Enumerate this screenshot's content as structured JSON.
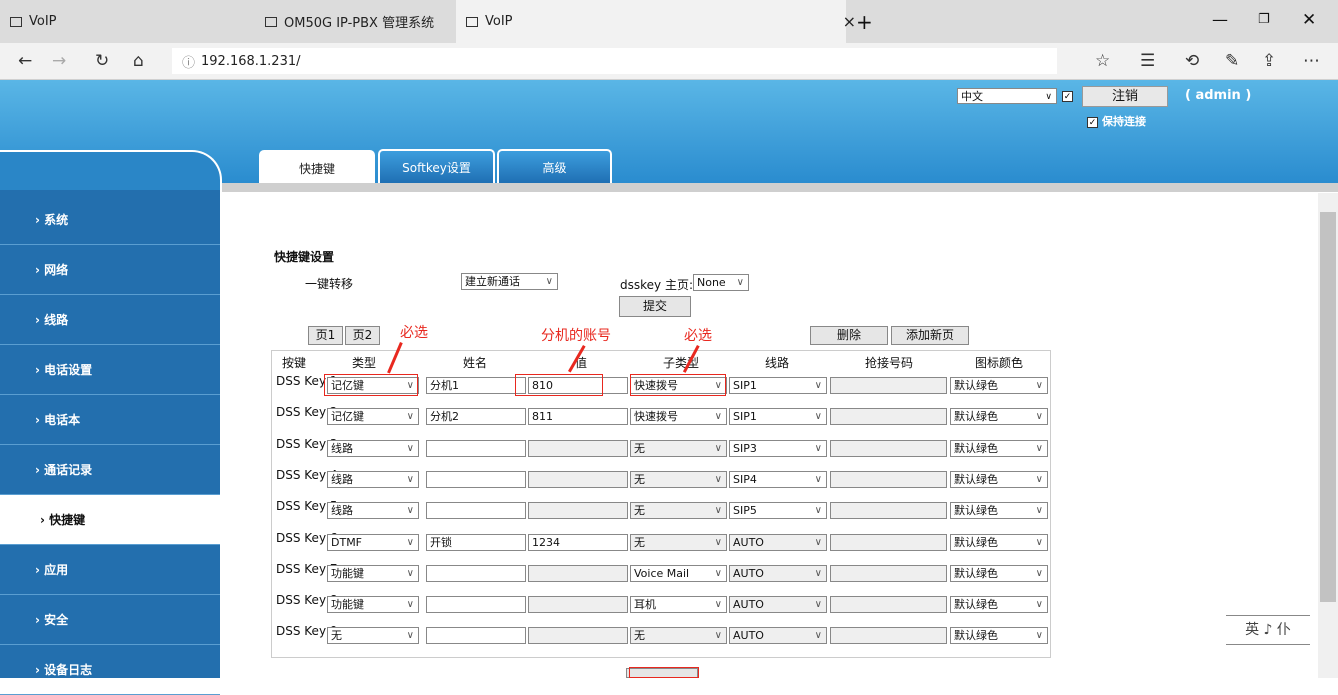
{
  "browser": {
    "tab1": "VoIP",
    "tab2": "OM50G IP-PBX 管理系统",
    "tab3": "VoIP",
    "url": "192.168.1.231/"
  },
  "header": {
    "language": "中文",
    "logout": "注销",
    "user": "( admin )",
    "keep_alive": "保持连接"
  },
  "tabs": [
    "快捷键",
    "Softkey设置",
    "高级"
  ],
  "sidebar": [
    "系统",
    "网络",
    "线路",
    "电话设置",
    "电话本",
    "通话记录",
    "快捷键",
    "应用",
    "安全",
    "设备日志"
  ],
  "section": {
    "title": "快捷键设置",
    "transfer_label": "一键转移",
    "transfer_value": "建立新通话",
    "dsskey_home_label": "dsskey 主页:",
    "dsskey_home_value": "None",
    "submit": "提交",
    "page1": "页1",
    "page2": "页2",
    "delete": "删除",
    "add_page": "添加新页"
  },
  "table": {
    "headers": [
      "按键",
      "类型",
      "姓名",
      "值",
      "子类型",
      "线路",
      "抢接号码",
      "图标颜色"
    ],
    "rows": [
      {
        "key": "DSS Key 1",
        "type": "记亿键",
        "name": "分机1",
        "value": "810",
        "subtype": "快速拨号",
        "line": "SIP1",
        "pickup": "",
        "color": "默认绿色"
      },
      {
        "key": "DSS Key 2",
        "type": "记亿键",
        "name": "分机2",
        "value": "811",
        "subtype": "快速拨号",
        "line": "SIP1",
        "pickup": "",
        "color": "默认绿色"
      },
      {
        "key": "DSS Key 3",
        "type": "线路",
        "name": "",
        "value": "",
        "subtype": "无",
        "line": "SIP3",
        "pickup": "",
        "color": "默认绿色"
      },
      {
        "key": "DSS Key 4",
        "type": "线路",
        "name": "",
        "value": "",
        "subtype": "无",
        "line": "SIP4",
        "pickup": "",
        "color": "默认绿色"
      },
      {
        "key": "DSS Key 5",
        "type": "线路",
        "name": "",
        "value": "",
        "subtype": "无",
        "line": "SIP5",
        "pickup": "",
        "color": "默认绿色"
      },
      {
        "key": "DSS Key 6",
        "type": "DTMF",
        "name": "开锁",
        "value": "1234",
        "subtype": "无",
        "line": "AUTO",
        "pickup": "",
        "color": "默认绿色"
      },
      {
        "key": "DSS Key 7",
        "type": "功能键",
        "name": "",
        "value": "",
        "subtype": "Voice Mail",
        "line": "AUTO",
        "pickup": "",
        "color": "默认绿色"
      },
      {
        "key": "DSS Key 8",
        "type": "功能键",
        "name": "",
        "value": "",
        "subtype": "耳机",
        "line": "AUTO",
        "pickup": "",
        "color": "默认绿色"
      },
      {
        "key": "DSS Key 9",
        "type": "无",
        "name": "",
        "value": "",
        "subtype": "无",
        "line": "AUTO",
        "pickup": "",
        "color": "默认绿色"
      }
    ]
  },
  "annotations": [
    "必选",
    "分机的账号",
    "必选"
  ],
  "ime": "英 ♪ 仆"
}
